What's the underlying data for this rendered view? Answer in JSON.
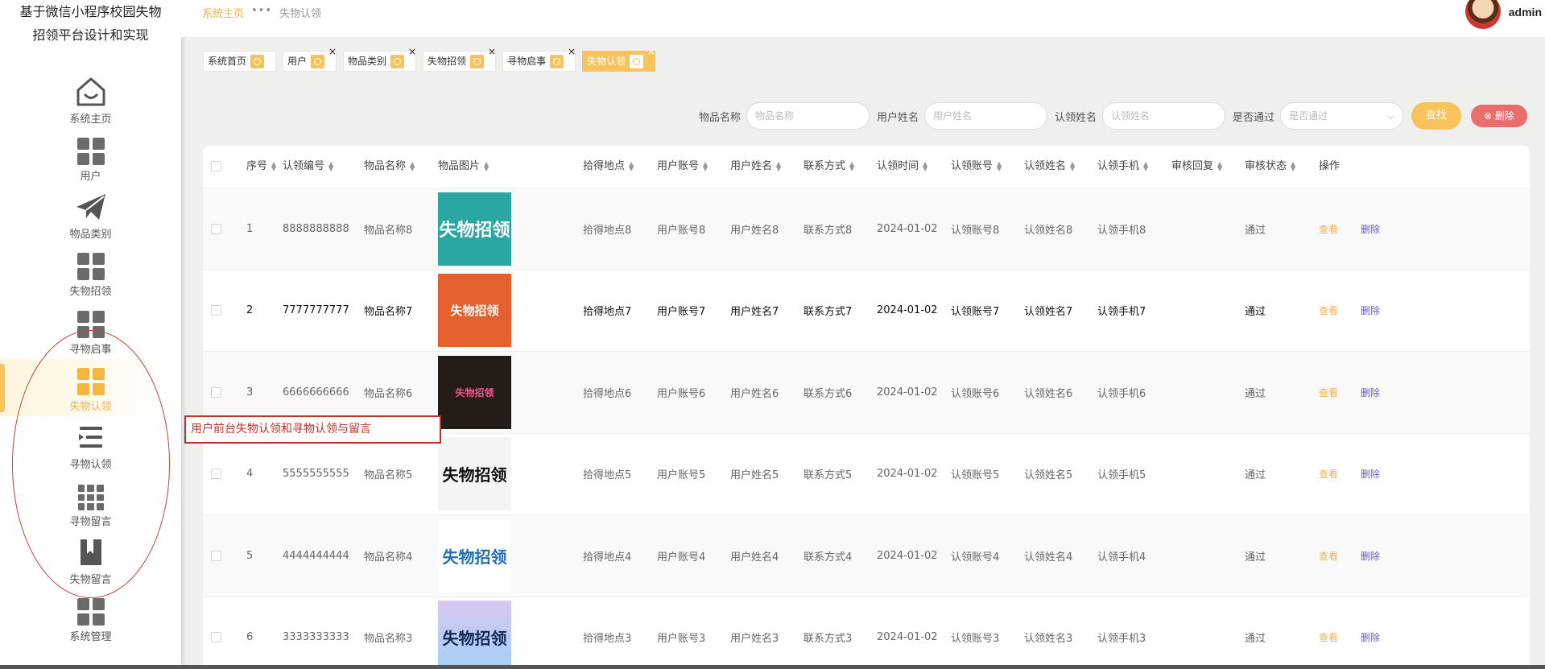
{
  "app": {
    "title_line1": "基于微信小程序校园失物",
    "title_line2": "招领平台设计和实现"
  },
  "sidebar": {
    "items": [
      {
        "label": "系统主页",
        "icon": "home-face-icon"
      },
      {
        "label": "用户",
        "icon": "grid-icon"
      },
      {
        "label": "物品类别",
        "icon": "paper-plane-icon"
      },
      {
        "label": "失物招领",
        "icon": "grid-icon"
      },
      {
        "label": "寻物启事",
        "icon": "grid-icon"
      },
      {
        "label": "失物认领",
        "icon": "grid-icon",
        "active": true
      },
      {
        "label": "寻物认领",
        "icon": "list-indent-icon"
      },
      {
        "label": "寻物留言",
        "icon": "grid9-icon"
      },
      {
        "label": "失物留言",
        "icon": "bookmark-icon"
      },
      {
        "label": "系统管理",
        "icon": "grid-icon"
      }
    ]
  },
  "header": {
    "breadcrumb_home": "系统主页",
    "breadcrumb_sep": "•••",
    "breadcrumb_current": "失物认领",
    "username": "admin"
  },
  "tabs": [
    {
      "label": "系统首页",
      "closable": false
    },
    {
      "label": "用户",
      "closable": true
    },
    {
      "label": "物品类别",
      "closable": true
    },
    {
      "label": "失物招领",
      "closable": true
    },
    {
      "label": "寻物启事",
      "closable": true
    },
    {
      "label": "失物认领",
      "closable": true,
      "active": true
    }
  ],
  "search": {
    "item_name_label": "物品名称",
    "item_name_placeholder": "物品名称",
    "user_name_label": "用户姓名",
    "user_name_placeholder": "用户姓名",
    "claim_name_label": "认领姓名",
    "claim_name_placeholder": "认领姓名",
    "passed_label": "是否通过",
    "passed_placeholder": "是否通过",
    "search_button": "查找",
    "delete_button": "删除"
  },
  "table": {
    "headers": [
      "序号",
      "认领编号",
      "物品名称",
      "物品图片",
      "拾得地点",
      "用户账号",
      "用户姓名",
      "联系方式",
      "认领时间",
      "认领账号",
      "认领姓名",
      "认领手机",
      "审核回复",
      "审核状态",
      "操作"
    ],
    "view_label": "查看",
    "delete_label": "删除",
    "rows": [
      {
        "idx": "1",
        "code": "8888888888",
        "name": "物品名称8",
        "img_text": "失物招领",
        "place": "拾得地点8",
        "account": "用户账号8",
        "uname": "用户姓名8",
        "contact": "联系方式8",
        "time": "2024-01-02",
        "c_account": "认领账号8",
        "c_name": "认领姓名8",
        "c_phone": "认领手机8",
        "reply": "",
        "status": "通过"
      },
      {
        "idx": "2",
        "code": "7777777777",
        "name": "物品名称7",
        "img_text": "失物招领",
        "place": "拾得地点7",
        "account": "用户账号7",
        "uname": "用户姓名7",
        "contact": "联系方式7",
        "time": "2024-01-02",
        "c_account": "认领账号7",
        "c_name": "认领姓名7",
        "c_phone": "认领手机7",
        "reply": "",
        "status": "通过"
      },
      {
        "idx": "3",
        "code": "6666666666",
        "name": "物品名称6",
        "img_text": "失物招领",
        "place": "拾得地点6",
        "account": "用户账号6",
        "uname": "用户姓名6",
        "contact": "联系方式6",
        "time": "2024-01-02",
        "c_account": "认领账号6",
        "c_name": "认领姓名6",
        "c_phone": "认领手机6",
        "reply": "",
        "status": "通过"
      },
      {
        "idx": "4",
        "code": "5555555555",
        "name": "物品名称5",
        "img_text": "失物招领",
        "place": "拾得地点5",
        "account": "用户账号5",
        "uname": "用户姓名5",
        "contact": "联系方式5",
        "time": "2024-01-02",
        "c_account": "认领账号5",
        "c_name": "认领姓名5",
        "c_phone": "认领手机5",
        "reply": "",
        "status": "通过"
      },
      {
        "idx": "5",
        "code": "4444444444",
        "name": "物品名称4",
        "img_text": "失物招领",
        "place": "拾得地点4",
        "account": "用户账号4",
        "uname": "用户姓名4",
        "contact": "联系方式4",
        "time": "2024-01-02",
        "c_account": "认领账号4",
        "c_name": "认领姓名4",
        "c_phone": "认领手机4",
        "reply": "",
        "status": "通过"
      },
      {
        "idx": "6",
        "code": "3333333333",
        "name": "物品名称3",
        "img_text": "失物招领",
        "place": "拾得地点3",
        "account": "用户账号3",
        "uname": "用户姓名3",
        "contact": "联系方式3",
        "time": "2024-01-02",
        "c_account": "认领账号3",
        "c_name": "认领姓名3",
        "c_phone": "认领手机3",
        "reply": "",
        "status": "通过"
      }
    ]
  },
  "annotation": {
    "text": "用户前台失物认领和寻物认领与留言"
  },
  "colors": {
    "accent": "#f7c35a",
    "danger": "#ec6b6b",
    "annotation": "#c0312b",
    "delete_link": "#6a5acd"
  }
}
